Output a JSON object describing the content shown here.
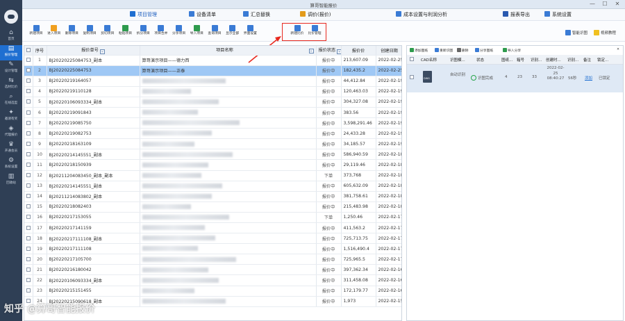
{
  "window": {
    "title": "算哥智能报价",
    "minimize": "—",
    "maximize": "☐",
    "close": "✕"
  },
  "sidebar": {
    "items": [
      {
        "label": "首页",
        "icon": "home-icon",
        "glyph": "⌂"
      },
      {
        "label": "报价管理",
        "icon": "quote-icon",
        "glyph": "▤"
      },
      {
        "label": "设计管理",
        "icon": "design-icon",
        "glyph": "✎"
      },
      {
        "label": "选材比价",
        "icon": "compare-icon",
        "glyph": "⇆"
      },
      {
        "label": "在线选型",
        "icon": "search-icon",
        "glyph": "⌕"
      },
      {
        "label": "邀请有奖",
        "icon": "gift-icon",
        "glyph": "✦"
      },
      {
        "label": "代理报价",
        "icon": "agent-icon",
        "glyph": "◈"
      },
      {
        "label": "开通会员",
        "icon": "vip-icon",
        "glyph": "♛"
      },
      {
        "label": "系统设置",
        "icon": "settings-icon",
        "glyph": "⚙"
      },
      {
        "label": "回收站",
        "icon": "trash-icon",
        "glyph": "▥"
      }
    ]
  },
  "menu": [
    {
      "label": "项目管理",
      "color": "#1f6fd1",
      "active": true
    },
    {
      "label": "设备清单",
      "color": "#3a7bd5"
    },
    {
      "label": "汇总替换",
      "color": "#3a7bd5"
    },
    {
      "label": "调价(报价)",
      "color": "#e39b1b"
    },
    {
      "label": "成本设置与利润分析",
      "color": "#3a7bd5"
    },
    {
      "label": "报表导出",
      "color": "#2a5ab0"
    },
    {
      "label": "系统设置",
      "color": "#3a7bd5"
    }
  ],
  "toolbar": [
    {
      "label": "新建项目",
      "color": "#3a7bd5"
    },
    {
      "label": "进入项目",
      "color": "#f0a020"
    },
    {
      "label": "删除项目",
      "color": "#3a7bd5"
    },
    {
      "label": "复制项目",
      "color": "#3a7bd5"
    },
    {
      "label": "剪切项目",
      "color": "#3a7bd5"
    },
    {
      "label": "粘贴项目",
      "color": "#2e9b4d"
    },
    {
      "label": "拆分项目",
      "color": "#3a7bd5"
    },
    {
      "label": "项目合并",
      "color": "#3a7bd5"
    },
    {
      "label": "分享项目",
      "color": "#3a7bd5"
    },
    {
      "label": "导入项目",
      "color": "#2e9b4d"
    },
    {
      "label": "查询项目",
      "color": "#3a7bd5"
    },
    {
      "label": "显示全部",
      "color": "#3a7bd5"
    },
    {
      "label": "界面设置",
      "color": "#3a7bd5"
    },
    {
      "label": "新建比价",
      "color": "#3a7bd5"
    },
    {
      "label": "比价管理",
      "color": "#3a7bd5"
    }
  ],
  "toolbar_right": [
    {
      "label": "智能识图",
      "color": "#3a7bd5"
    },
    {
      "label": "视频教程",
      "color": "#f0c020"
    }
  ],
  "table": {
    "columns": [
      "序号",
      "报价单号",
      "项目名称",
      "报价状态",
      "报价价",
      "创建日期"
    ],
    "rows": [
      {
        "n": "1",
        "id": "BJ20220225084753_副本",
        "name": "算哥演示项目——德力西",
        "status": "报价中",
        "price": "213,607.09",
        "date": "2022-02-25",
        "blur": false
      },
      {
        "n": "2",
        "id": "BJ20220225084753",
        "name": "算哥演示项目——正泰",
        "status": "报价中",
        "price": "182,435.2",
        "date": "2022-02-25",
        "blur": false,
        "selected": true
      },
      {
        "n": "3",
        "id": "BJ20220219164057",
        "name": "",
        "status": "报价中",
        "price": "44,412.84",
        "date": "2022-02-19",
        "blur": true
      },
      {
        "n": "4",
        "id": "BJ20220219110128",
        "name": "",
        "status": "报价中",
        "price": "120,463.03",
        "date": "2022-02-19",
        "blur": true
      },
      {
        "n": "5",
        "id": "BJ20220106093334_副本",
        "name": "",
        "status": "报价中",
        "price": "304,327.08",
        "date": "2022-02-19",
        "blur": true
      },
      {
        "n": "6",
        "id": "BJ20220219091843",
        "name": "",
        "status": "报价中",
        "price": "383.56",
        "date": "2022-02-19",
        "blur": true
      },
      {
        "n": "7",
        "id": "BJ20220219085750",
        "name": "",
        "status": "报价中",
        "price": "3,598,291.46",
        "date": "2022-02-19",
        "blur": true
      },
      {
        "n": "8",
        "id": "BJ20220219082753",
        "name": "",
        "status": "报价中",
        "price": "24,433.28",
        "date": "2022-02-19",
        "blur": true
      },
      {
        "n": "9",
        "id": "BJ20220218163109",
        "name": "",
        "status": "报价中",
        "price": "34,185.57",
        "date": "2022-02-19",
        "blur": true
      },
      {
        "n": "10",
        "id": "BJ20220214145551_副本",
        "name": "",
        "status": "报价中",
        "price": "586,940.59",
        "date": "2022-02-18",
        "blur": true
      },
      {
        "n": "11",
        "id": "BJ20220218150939",
        "name": "",
        "status": "报价中",
        "price": "29,119.46",
        "date": "2022-02-18",
        "blur": true
      },
      {
        "n": "12",
        "id": "BJ20211204083450_副本_副本",
        "name": "",
        "status": "下单",
        "price": "373,768",
        "date": "2022-02-18",
        "blur": true
      },
      {
        "n": "13",
        "id": "BJ20220214145551_副本",
        "name": "",
        "status": "报价中",
        "price": "605,632.09",
        "date": "2022-02-18",
        "blur": true
      },
      {
        "n": "14",
        "id": "BJ20211214083802_副本",
        "name": "",
        "status": "报价中",
        "price": "381,758.61",
        "date": "2022-02-18",
        "blur": true
      },
      {
        "n": "15",
        "id": "BJ20220218082403",
        "name": "",
        "status": "报价中",
        "price": "215,483.98",
        "date": "2022-02-18",
        "blur": true
      },
      {
        "n": "16",
        "id": "BJ20220217153055",
        "name": "",
        "status": "下单",
        "price": "1,250.46",
        "date": "2022-02-17",
        "blur": true
      },
      {
        "n": "17",
        "id": "BJ20220217141159",
        "name": "",
        "status": "报价中",
        "price": "411,563.2",
        "date": "2022-02-17",
        "blur": true
      },
      {
        "n": "18",
        "id": "BJ20220217111108_副本",
        "name": "",
        "status": "报价中",
        "price": "725,713.75",
        "date": "2022-02-17",
        "blur": true
      },
      {
        "n": "19",
        "id": "BJ20220217111108",
        "name": "",
        "status": "报价中",
        "price": "1,516,490.4",
        "date": "2022-02-17",
        "blur": true
      },
      {
        "n": "20",
        "id": "BJ20220217105700",
        "name": "",
        "status": "报价中",
        "price": "725,965.5",
        "date": "2022-02-17",
        "blur": true
      },
      {
        "n": "21",
        "id": "BJ20220216180042",
        "name": "",
        "status": "报价中",
        "price": "397,362.34",
        "date": "2022-02-16",
        "blur": true
      },
      {
        "n": "22",
        "id": "BJ20220106093334_副本",
        "name": "",
        "status": "报价中",
        "price": "311,458.08",
        "date": "2022-02-16",
        "blur": true
      },
      {
        "n": "23",
        "id": "BJ20220215151455",
        "name": "",
        "status": "报价中",
        "price": "172,179.77",
        "date": "2022-02-16",
        "blur": true
      },
      {
        "n": "24",
        "id": "BJ20220215090618_副本",
        "name": "",
        "status": "报价中",
        "price": "1,973",
        "date": "2022-02-15",
        "blur": true
      }
    ]
  },
  "rpanel": {
    "tools": [
      {
        "label": "添加图纸",
        "color": "#2e9b4d"
      },
      {
        "label": "重新识图",
        "color": "#3a7bd5"
      },
      {
        "label": "删除",
        "color": "#666"
      },
      {
        "label": "分享图纸",
        "color": "#3a7bd5"
      },
      {
        "label": "导入分享",
        "color": "#2e9b4d"
      }
    ],
    "close": "✕",
    "headers": [
      "CAD名称",
      "识图模...",
      "状态",
      "图纸...",
      "箱号",
      "识别...",
      "创建时...",
      "识别...",
      "备注",
      "锁定..."
    ],
    "row": {
      "file_badge": "DWG",
      "mode": "自动识别",
      "status": "识图完成",
      "sheets": "4",
      "boxes": "23",
      "recognized": "33",
      "created": "2022-02-25 08:40:27",
      "time": "56秒",
      "note": "添加",
      "locked": "已锁定"
    }
  },
  "watermark": "知乎 @算哥智能报价"
}
